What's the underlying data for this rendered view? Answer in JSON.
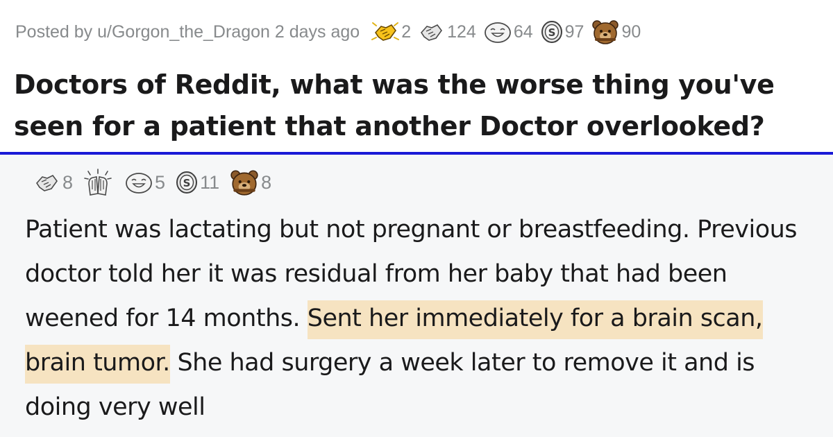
{
  "post": {
    "posted_by": "Posted by u/Gorgon_the_Dragon 2 days ago",
    "awards": [
      {
        "icon": "gold-handshake-award-icon",
        "count": "2"
      },
      {
        "icon": "silver-handshake-award-icon",
        "count": "124"
      },
      {
        "icon": "laughing-face-award-icon",
        "count": "64"
      },
      {
        "icon": "silver-coin-award-icon",
        "count": "97"
      },
      {
        "icon": "bear-award-icon",
        "count": "90"
      }
    ],
    "title": "Doctors of Reddit, what was the worse thing you've seen for a patient that another Doctor overlooked?"
  },
  "comment": {
    "awards": [
      {
        "icon": "handshake-award-icon",
        "count": "8"
      },
      {
        "icon": "clapping-hands-award-icon",
        "count": ""
      },
      {
        "icon": "laughing-face-award-icon",
        "count": "5"
      },
      {
        "icon": "silver-coin-award-icon",
        "count": "11"
      },
      {
        "icon": "bear-award-icon",
        "count": "8"
      }
    ],
    "text_before": "Patient was lactating but not pregnant or breastfeeding. Previous doctor told her it was residual from her baby that had been weened for 14 months. ",
    "text_highlight": "Sent her immediately for a brain scan, brain tumor.",
    "text_after": " She had surgery a week later to remove it and is doing very well"
  },
  "colors": {
    "divider": "#1a1ad6",
    "highlight": "#f6e3c1",
    "meta_text": "#878a8c",
    "title_text": "#1a1a1b",
    "comment_bg": "#f6f7f8"
  }
}
